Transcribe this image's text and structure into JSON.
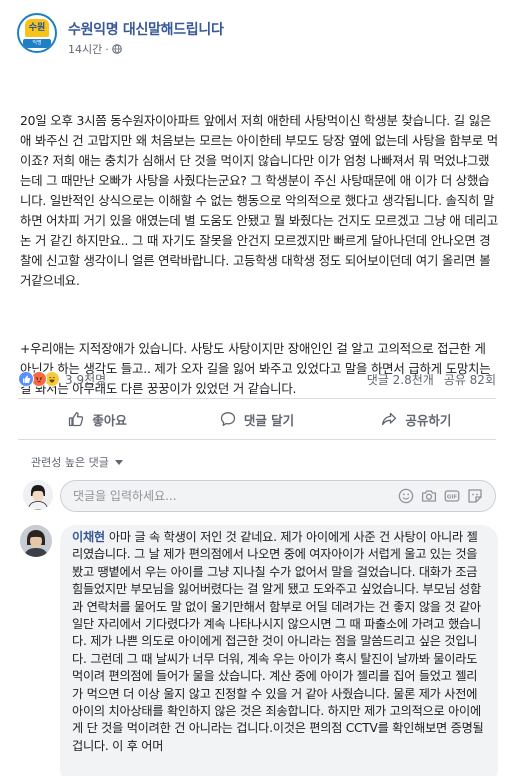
{
  "page": {
    "name": "수원익명 대신말해드립니다",
    "time": "14시간",
    "logo_top": "수원",
    "logo_bottom": "익명"
  },
  "post": {
    "paragraph1": "20일 오후 3시쯤 동수원자이아파트 앞에서 저희 애한테 사탕먹이신 학생분 찾습니다. 길 잃은 애 봐주신 건 고맙지만 왜 처음보는 모르는 아이한테 부모도 당장 옆에 없는데 사탕을 함부로 먹이죠? 저희 애는 충치가 심해서 단 것을 먹이지 않습니다만 이가 엄청 나빠져서 뭐 먹었냐그랬는데 그 때만난 오빠가 사탕을 사줬다는군요? 그 학생분이 주신 사탕때문에 애 이가 더 상했습니다. 일반적인 상식으로는 이해할 수 없는 행동으로 악의적으로 했다고 생각됩니다. 솔직히 말하면 어차피 거기 있을 애였는데 별 도움도 안됐고 뭘 봐줬다는 건지도 모르겠고 그냥 애 데리고 논 거 같긴 하지만요.. 그 때 자기도 잘못을 안건지 모르겠지만 빠르게 달아나던데 안나오면 경찰에 신고할 생각이니 얼른 연락바랍니다. 고등학생 대학생 정도 되어보이던데 여기 올리면 볼거같으네요.",
    "paragraph2": "+우리애는 지적장애가 있습니다. 사탕도 사탕이지만 장애인인 걸 알고 고의적으로 접근한 게 아닌가 하는 생각도 들고.. 제가 오자 길을 잃어 봐주고 있었다고 말을 하면서 급하게 도망치는 걸 봐서는 아무래도 다른 꿍꿍이가 있었던 거 같습니다."
  },
  "stats": {
    "reactions": "3.9천명",
    "comments": "댓글 2.8천개",
    "shares": "공유 82회"
  },
  "actions": {
    "like": "좋아요",
    "comment": "댓글 달기",
    "share": "공유하기"
  },
  "comments_section": {
    "filter_label": "관련성 높은 댓글",
    "input_placeholder": "댓글을 입력하세요..."
  },
  "comment": {
    "author": "이채현",
    "text": "아마 글 속 학생이 저인 것 같네요. 제가 아이에게 사준 건 사탕이 아니라 젤리였습니다. 그 날 제가 편의점에서 나오면 중에 여자아이가 서럽게 울고 있는 것을 봤고 땡볕에서 우는 아이를 그냥 지나칠 수가 없어서 말을 걸었습니다. 대화가 조금 힘들었지만 부모님을 잃어버렸다는 걸 알게 됐고 도와주고 싶었습니다. 부모님 성함과 연락처를 물어도 말 없이 울기만해서 함부로 어딜 데려가는 건 좋지 않을 것 같아 일단 자리에서 기다렸다가 계속 나타나시지 않으시면 그 때 파출소에 가려고 했습니다. 제가 나쁜 의도로 아이에게 접근한 것이 아니라는 점을 말씀드리고 싶은 것입니다. 그런데 그 때 날씨가 너무 더워, 계속 우는 아이가 혹시 탈진이 날까봐 물이라도 먹이려 편의점에 들어가 물을 샀습니다. 계산 중에 아이가 젤리를 집어 들었고 젤리가 먹으면 더 이상 울지 않고 진정할 수 있을 거 같아 사줬습니다. 물론 제가 사전에 아이의 치아상태를 확인하지 않은 것은 죄송합니다. 하지만 제가 고의적으로 아이에게 단 것을 먹이려한 건 아니라는 겁니다.이것은 편의점 CCTV를 확인해보면 증명될 겁니다. 이 후 어머"
  }
}
